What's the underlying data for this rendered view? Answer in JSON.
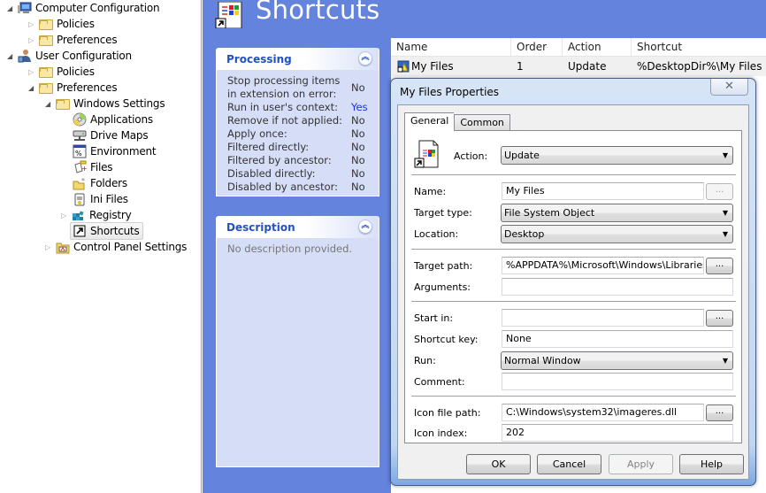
{
  "tree": {
    "items": [
      {
        "label": "Computer Configuration",
        "expander": "expanded",
        "icon": "computer-icon",
        "level": 0
      },
      {
        "label": "Policies",
        "expander": "collapsed",
        "icon": "folder-icon",
        "level": 1
      },
      {
        "label": "Preferences",
        "expander": "collapsed",
        "icon": "folder-icon",
        "level": 1
      },
      {
        "label": "User Configuration",
        "expander": "expanded",
        "icon": "user-icon",
        "level": 0
      },
      {
        "label": "Policies",
        "expander": "collapsed",
        "icon": "folder-icon",
        "level": 1
      },
      {
        "label": "Preferences",
        "expander": "expanded",
        "icon": "folder-icon",
        "level": 1
      },
      {
        "label": "Windows Settings",
        "expander": "expanded",
        "icon": "folder-icon",
        "level": 2
      },
      {
        "label": "Applications",
        "expander": "none",
        "icon": "applications-icon",
        "level": 3
      },
      {
        "label": "Drive Maps",
        "expander": "none",
        "icon": "drive-maps-icon",
        "level": 3
      },
      {
        "label": "Environment",
        "expander": "none",
        "icon": "environment-icon",
        "level": 3
      },
      {
        "label": "Files",
        "expander": "none",
        "icon": "files-icon",
        "level": 3
      },
      {
        "label": "Folders",
        "expander": "none",
        "icon": "folders-icon",
        "level": 3
      },
      {
        "label": "Ini Files",
        "expander": "none",
        "icon": "ini-files-icon",
        "level": 3
      },
      {
        "label": "Registry",
        "expander": "collapsed",
        "icon": "registry-icon",
        "level": 3
      },
      {
        "label": "Shortcuts",
        "expander": "none",
        "icon": "shortcut-icon",
        "level": 3,
        "selected": true
      },
      {
        "label": "Control Panel Settings",
        "expander": "collapsed",
        "icon": "control-panel-icon",
        "level": 2
      }
    ]
  },
  "header": {
    "title": "Shortcuts",
    "icon": "shortcut-header-icon"
  },
  "processing": {
    "title": "Processing",
    "rows": [
      {
        "label": "Stop processing items in extension on error:",
        "value": "No"
      },
      {
        "label": "Run in user's context:",
        "value": "Yes"
      },
      {
        "label": "Remove if not applied:",
        "value": "No"
      },
      {
        "label": "Apply once:",
        "value": "No"
      },
      {
        "label": "Filtered directly:",
        "value": "No"
      },
      {
        "label": "Filtered by ancestor:",
        "value": "No"
      },
      {
        "label": "Disabled directly:",
        "value": "No"
      },
      {
        "label": "Disabled by ancestor:",
        "value": "No"
      }
    ]
  },
  "description": {
    "title": "Description",
    "text": "No description provided."
  },
  "listview": {
    "columns": [
      "Name",
      "Order",
      "Action",
      "Shortcut"
    ],
    "rows": [
      {
        "name": "My Files",
        "order": "1",
        "action": "Update",
        "shortcut": "%DesktopDir%\\My Files"
      }
    ]
  },
  "dialog": {
    "title": "My Files Properties",
    "close_label": "✕",
    "tabs": [
      "General",
      "Common"
    ],
    "active_tab": "General",
    "fields": {
      "action": {
        "label": "Action:",
        "value": "Update"
      },
      "name": {
        "label": "Name:",
        "value": "My Files"
      },
      "target_type": {
        "label": "Target type:",
        "value": "File System Object"
      },
      "location": {
        "label": "Location:",
        "value": "Desktop"
      },
      "target_path": {
        "label": "Target path:",
        "value": "%APPDATA%\\Microsoft\\Windows\\Libraries"
      },
      "arguments": {
        "label": "Arguments:",
        "value": ""
      },
      "start_in": {
        "label": "Start in:",
        "value": ""
      },
      "shortcut_key": {
        "label": "Shortcut key:",
        "value": "None"
      },
      "run": {
        "label": "Run:",
        "value": "Normal Window"
      },
      "comment": {
        "label": "Comment:",
        "value": ""
      },
      "icon_file_path": {
        "label": "Icon file path:",
        "value": "C:\\Windows\\system32\\imageres.dll"
      },
      "icon_index": {
        "label": "Icon index:",
        "value": "202"
      }
    },
    "browse_label": "...",
    "buttons": {
      "ok": "OK",
      "cancel": "Cancel",
      "apply": "Apply",
      "help": "Help"
    }
  }
}
